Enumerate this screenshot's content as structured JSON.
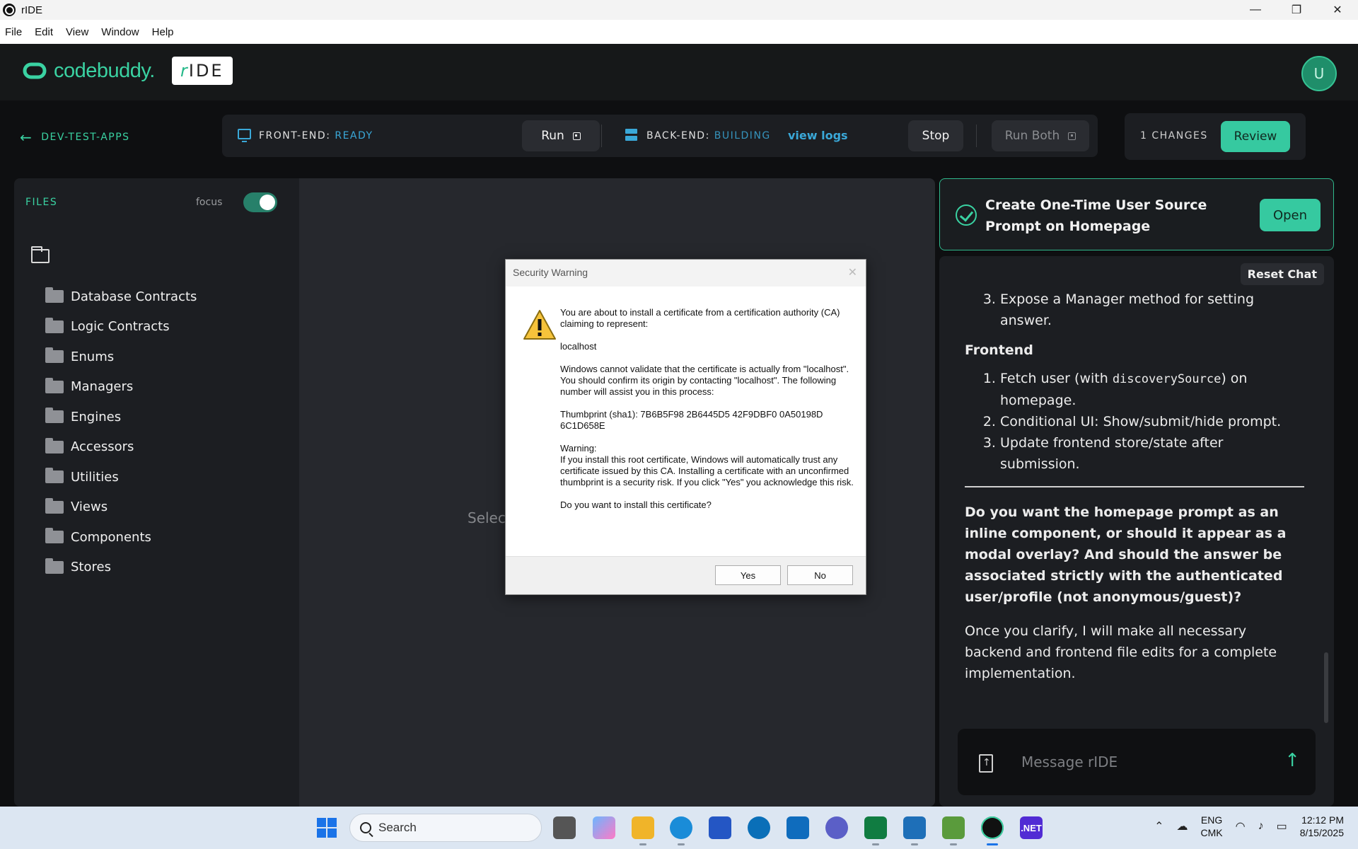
{
  "window": {
    "title": "rIDE",
    "minimize": "—",
    "maximize": "❐",
    "close": "✕"
  },
  "menu": [
    "File",
    "Edit",
    "View",
    "Window",
    "Help"
  ],
  "header": {
    "brand": "codebuddy.",
    "product_prefix": "r",
    "product": "IDE",
    "avatar_initial": "U"
  },
  "toolbar": {
    "back_label": "DEV-TEST-APPS",
    "frontend_label": "FRONT-END:",
    "frontend_status": "READY",
    "run_label": "Run",
    "backend_label": "BACK-END:",
    "backend_status": "BUILDING",
    "view_logs": "view logs",
    "stop_label": "Stop",
    "run_both_label": "Run Both",
    "changes_label": "1 CHANGES",
    "review_label": "Review"
  },
  "files": {
    "title": "FILES",
    "focus_label": "focus",
    "focus_on": true,
    "folders": [
      "Database Contracts",
      "Logic Contracts",
      "Enums",
      "Managers",
      "Engines",
      "Accessors",
      "Utilities",
      "Views",
      "Components",
      "Stores"
    ]
  },
  "editor": {
    "placeholder": "Selec"
  },
  "task": {
    "title": "Create One-Time User Source Prompt on Homepage",
    "open_label": "Open"
  },
  "chat": {
    "reset_label": "Reset Chat",
    "backend_item3_num": "3.",
    "backend_item3": "Expose a Manager method for setting answer.",
    "frontend_heading": "Frontend",
    "frontend_item1_a": "Fetch user (with ",
    "frontend_item1_code": "discoverySource",
    "frontend_item1_b": ") on homepage.",
    "frontend_item2": "Conditional UI: Show/submit/hide prompt.",
    "frontend_item3": "Update frontend store/state after submission.",
    "question": "Do you want the homepage prompt as an inline component, or should it appear as a modal overlay? And should the answer be associated strictly with the authenticated user/profile (not anonymous/guest)?",
    "closing": "Once you clarify, I will make all necessary backend and frontend file edits for a complete implementation.",
    "input_placeholder": "Message rIDE"
  },
  "dialog": {
    "title": "Security Warning",
    "close": "✕",
    "p1": "You are about to install a certificate from a certification authority (CA) claiming to represent:",
    "p2": "localhost",
    "p3": "Windows cannot validate that the certificate is actually from \"localhost\". You should confirm its origin by contacting \"localhost\". The following number will assist you in this process:",
    "p4": "Thumbprint (sha1): 7B6B5F98 2B6445D5 42F9DBF0 0A50198D 6C1D658E",
    "p5_head": "Warning:",
    "p5": "If you install this root certificate, Windows will automatically trust any certificate issued by this CA. Installing a certificate with an unconfirmed thumbprint is a security risk. If you click \"Yes\" you acknowledge this risk.",
    "p6": "Do you want to install this certificate?",
    "yes": "Yes",
    "no": "No"
  },
  "taskbar": {
    "search_label": "Search",
    "lang_line1": "ENG",
    "lang_line2": "CMK",
    "time": "12:12 PM",
    "date": "8/15/2025",
    "net_label": ".NET"
  },
  "colors": {
    "accent": "#3ad2a2",
    "status_blue": "#3aa8d8",
    "panel": "#1c1e22",
    "editor": "#26282d"
  }
}
